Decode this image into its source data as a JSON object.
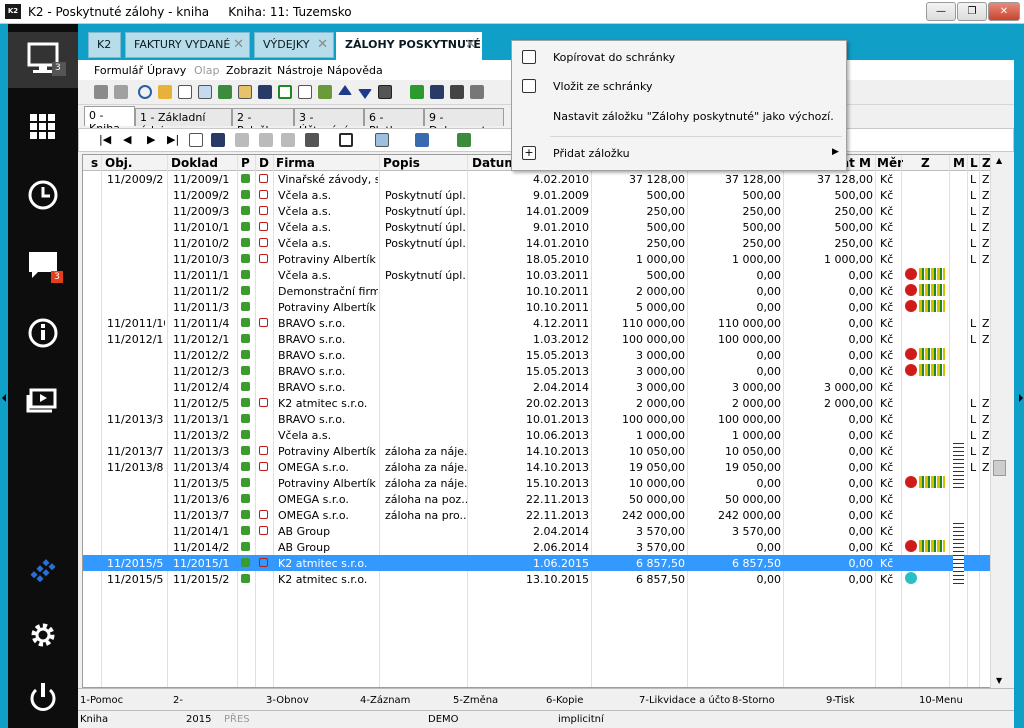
{
  "window": {
    "title": "K2 - Poskytnuté zálohy - kniha",
    "book": "Kniha: 11: Tuzemsko",
    "icon": "K2"
  },
  "sidebar": {
    "items": [
      {
        "name": "desktop-icon",
        "badge": "3"
      },
      {
        "name": "apps-grid-icon",
        "badge": ""
      },
      {
        "name": "history-icon",
        "badge": ""
      },
      {
        "name": "messages-icon",
        "badge": "3"
      },
      {
        "name": "info-icon",
        "badge": ""
      },
      {
        "name": "media-icon",
        "badge": ""
      },
      {
        "name": "k2-logo-icon",
        "badge": ""
      },
      {
        "name": "settings-icon",
        "badge": ""
      },
      {
        "name": "power-icon",
        "badge": ""
      }
    ]
  },
  "tabs": [
    {
      "label": "K2"
    },
    {
      "label": "FAKTURY VYDANÉ"
    },
    {
      "label": "VÝDEJKY"
    },
    {
      "label": "ZÁLOHY POSKYTNUTÉ"
    }
  ],
  "menu": [
    "Formulář",
    "Úpravy",
    "Olap",
    "Zobrazit",
    "Nástroje",
    "Nápověda"
  ],
  "subtabs": [
    "0 - Kniha",
    "1 - Základní údaje",
    "2 - Položky",
    "3 - Účtování",
    "6 - Platby",
    "9 - Dokumenty"
  ],
  "columns": [
    "s",
    "Obj.",
    "Doklad",
    "P",
    "D",
    "Firma",
    "Popis",
    "Datum",
    "at M",
    "Měr",
    "Z",
    "M",
    "L",
    "Z"
  ],
  "rows": [
    {
      "obj": "11/2009/2",
      "doklad": "11/2009/1",
      "dl": true,
      "firma": "Vinařské závody, s...",
      "popis": "",
      "datum": "4.02.2010",
      "a": "37 128,00",
      "b": "37 128,00",
      "c": "37 128,00",
      "mena": "Kč",
      "z": "",
      "m": "",
      "l": "L",
      "z2": "Z"
    },
    {
      "obj": "",
      "doklad": "11/2009/2",
      "dl": true,
      "firma": "Včela a.s.",
      "popis": "Poskytnutí úpl...",
      "datum": "9.01.2009",
      "a": "500,00",
      "b": "500,00",
      "c": "500,00",
      "mena": "Kč",
      "z": "",
      "m": "",
      "l": "L",
      "z2": "Z"
    },
    {
      "obj": "",
      "doklad": "11/2009/3",
      "dl": true,
      "firma": "Včela a.s.",
      "popis": "Poskytnutí úpl...",
      "datum": "14.01.2009",
      "a": "250,00",
      "b": "250,00",
      "c": "250,00",
      "mena": "Kč",
      "z": "",
      "m": "",
      "l": "L",
      "z2": "Z"
    },
    {
      "obj": "",
      "doklad": "11/2010/1",
      "dl": true,
      "firma": "Včela a.s.",
      "popis": "Poskytnutí úpl...",
      "datum": "9.01.2010",
      "a": "500,00",
      "b": "500,00",
      "c": "500,00",
      "mena": "Kč",
      "z": "",
      "m": "",
      "l": "L",
      "z2": "Z"
    },
    {
      "obj": "",
      "doklad": "11/2010/2",
      "dl": true,
      "firma": "Včela a.s.",
      "popis": "Poskytnutí úpl...",
      "datum": "14.01.2010",
      "a": "250,00",
      "b": "250,00",
      "c": "250,00",
      "mena": "Kč",
      "z": "",
      "m": "",
      "l": "L",
      "z2": "Z"
    },
    {
      "obj": "",
      "doklad": "11/2010/3",
      "dl": true,
      "firma": "Potraviny Albertík",
      "popis": "",
      "datum": "18.05.2010",
      "a": "1 000,00",
      "b": "1 000,00",
      "c": "1 000,00",
      "mena": "Kč",
      "z": "",
      "m": "",
      "l": "L",
      "z2": "Z"
    },
    {
      "obj": "",
      "doklad": "11/2011/1",
      "dl": false,
      "firma": "Včela a.s.",
      "popis": "Poskytnutí úpl...",
      "datum": "10.03.2011",
      "a": "500,00",
      "b": "0,00",
      "c": "0,00",
      "mena": "Kč",
      "z": "red",
      "m": "",
      "l": "",
      "z2": ""
    },
    {
      "obj": "",
      "doklad": "11/2011/2",
      "dl": false,
      "firma": "Demonstrační firm...",
      "popis": "",
      "datum": "10.10.2011",
      "a": "2 000,00",
      "b": "0,00",
      "c": "0,00",
      "mena": "Kč",
      "z": "red",
      "m": "",
      "l": "",
      "z2": ""
    },
    {
      "obj": "",
      "doklad": "11/2011/3",
      "dl": false,
      "firma": "Potraviny Albertík",
      "popis": "",
      "datum": "10.10.2011",
      "a": "5 000,00",
      "b": "0,00",
      "c": "0,00",
      "mena": "Kč",
      "z": "red",
      "m": "",
      "l": "",
      "z2": ""
    },
    {
      "obj": "11/2011/10",
      "doklad": "11/2011/4",
      "dl": true,
      "firma": "BRAVO s.r.o.",
      "popis": "",
      "datum": "4.12.2011",
      "a": "110 000,00",
      "b": "110 000,00",
      "c": "0,00",
      "mena": "Kč",
      "z": "",
      "m": "",
      "l": "L",
      "z2": "Z"
    },
    {
      "obj": "11/2012/1",
      "doklad": "11/2012/1",
      "dl": false,
      "firma": "BRAVO s.r.o.",
      "popis": "",
      "datum": "1.03.2012",
      "a": "100 000,00",
      "b": "100 000,00",
      "c": "0,00",
      "mena": "Kč",
      "z": "",
      "m": "",
      "l": "L",
      "z2": "Z"
    },
    {
      "obj": "",
      "doklad": "11/2012/2",
      "dl": false,
      "firma": "BRAVO s.r.o.",
      "popis": "",
      "datum": "15.05.2013",
      "a": "3 000,00",
      "b": "0,00",
      "c": "0,00",
      "mena": "Kč",
      "z": "red",
      "m": "",
      "l": "",
      "z2": ""
    },
    {
      "obj": "",
      "doklad": "11/2012/3",
      "dl": false,
      "firma": "BRAVO s.r.o.",
      "popis": "",
      "datum": "15.05.2013",
      "a": "3 000,00",
      "b": "0,00",
      "c": "0,00",
      "mena": "Kč",
      "z": "red",
      "m": "",
      "l": "",
      "z2": ""
    },
    {
      "obj": "",
      "doklad": "11/2012/4",
      "dl": false,
      "firma": "BRAVO s.r.o.",
      "popis": "",
      "datum": "2.04.2014",
      "a": "3 000,00",
      "b": "3 000,00",
      "c": "3 000,00",
      "mena": "Kč",
      "z": "",
      "m": "",
      "l": "",
      "z2": ""
    },
    {
      "obj": "",
      "doklad": "11/2012/5",
      "dl": true,
      "firma": "K2 atmitec s.r.o.",
      "popis": "",
      "datum": "20.02.2013",
      "a": "2 000,00",
      "b": "2 000,00",
      "c": "2 000,00",
      "mena": "Kč",
      "z": "",
      "m": "",
      "l": "L",
      "z2": "Z"
    },
    {
      "obj": "11/2013/3",
      "doklad": "11/2013/1",
      "dl": false,
      "firma": "BRAVO s.r.o.",
      "popis": "",
      "datum": "10.01.2013",
      "a": "100 000,00",
      "b": "100 000,00",
      "c": "0,00",
      "mena": "Kč",
      "z": "",
      "m": "",
      "l": "L",
      "z2": "Z"
    },
    {
      "obj": "",
      "doklad": "11/2013/2",
      "dl": false,
      "firma": "Včela a.s.",
      "popis": "",
      "datum": "10.06.2013",
      "a": "1 000,00",
      "b": "1 000,00",
      "c": "0,00",
      "mena": "Kč",
      "z": "",
      "m": "",
      "l": "L",
      "z2": "Z"
    },
    {
      "obj": "11/2013/7",
      "doklad": "11/2013/3",
      "dl": true,
      "firma": "Potraviny Albertík",
      "popis": "záloha za náje...",
      "datum": "14.10.2013",
      "a": "10 050,00",
      "b": "10 050,00",
      "c": "0,00",
      "mena": "Kč",
      "z": "",
      "m": "tree",
      "l": "L",
      "z2": "Z"
    },
    {
      "obj": "11/2013/8",
      "doklad": "11/2013/4",
      "dl": true,
      "firma": "OMEGA s.r.o.",
      "popis": "záloha za náje...",
      "datum": "14.10.2013",
      "a": "19 050,00",
      "b": "19 050,00",
      "c": "0,00",
      "mena": "Kč",
      "z": "",
      "m": "tree",
      "l": "L",
      "z2": "Z"
    },
    {
      "obj": "",
      "doklad": "11/2013/5",
      "dl": false,
      "firma": "Potraviny Albertík",
      "popis": "záloha za náje...",
      "datum": "15.10.2013",
      "a": "10 000,00",
      "b": "0,00",
      "c": "0,00",
      "mena": "Kč",
      "z": "red",
      "m": "tree",
      "l": "",
      "z2": ""
    },
    {
      "obj": "",
      "doklad": "11/2013/6",
      "dl": false,
      "firma": "OMEGA s.r.o.",
      "popis": "záloha na poz...",
      "datum": "22.11.2013",
      "a": "50 000,00",
      "b": "50 000,00",
      "c": "0,00",
      "mena": "Kč",
      "z": "",
      "m": "",
      "l": "",
      "z2": ""
    },
    {
      "obj": "",
      "doklad": "11/2013/7",
      "dl": true,
      "firma": "OMEGA s.r.o.",
      "popis": "záloha na pro...",
      "datum": "22.11.2013",
      "a": "242 000,00",
      "b": "242 000,00",
      "c": "0,00",
      "mena": "Kč",
      "z": "",
      "m": "",
      "l": "",
      "z2": ""
    },
    {
      "obj": "",
      "doklad": "11/2014/1",
      "dl": true,
      "firma": "AB Group",
      "popis": "",
      "datum": "2.04.2014",
      "a": "3 570,00",
      "b": "3 570,00",
      "c": "0,00",
      "mena": "Kč",
      "z": "",
      "m": "tree",
      "l": "",
      "z2": ""
    },
    {
      "obj": "",
      "doklad": "11/2014/2",
      "dl": false,
      "firma": "AB Group",
      "popis": "",
      "datum": "2.06.2014",
      "a": "3 570,00",
      "b": "0,00",
      "c": "0,00",
      "mena": "Kč",
      "z": "red",
      "m": "tree",
      "l": "",
      "z2": ""
    },
    {
      "obj": "11/2015/5",
      "doklad": "11/2015/1",
      "dl": true,
      "firma": "K2 atmitec s.r.o.",
      "popis": "",
      "datum": "1.06.2015",
      "a": "6 857,50",
      "b": "6 857,50",
      "c": "0,00",
      "mena": "Kč",
      "z": "",
      "m": "tree",
      "l": "",
      "z2": "",
      "selected": true
    },
    {
      "obj": "11/2015/5",
      "doklad": "11/2015/2",
      "dl": false,
      "firma": "K2 atmitec s.r.o.",
      "popis": "",
      "datum": "13.10.2015",
      "a": "6 857,50",
      "b": "0,00",
      "c": "0,00",
      "mena": "Kč",
      "z": "green",
      "m": "tree",
      "l": "",
      "z2": ""
    }
  ],
  "context_menu": {
    "items": [
      {
        "label": "Kopírovat do schránky",
        "icon": "copy-icon"
      },
      {
        "label": "Vložit ze schránky",
        "icon": "paste-icon"
      },
      {
        "label": "Nastavit záložku \"Zálohy poskytnuté\" jako výchozí.",
        "icon": ""
      },
      {
        "label": "Přidat záložku",
        "icon": "add-icon",
        "submenu": true
      }
    ]
  },
  "fkeys": [
    "1-Pomoc",
    "2-",
    "3-Obnov",
    "4-Záznam",
    "5-Změna",
    "6-Kopie",
    "7-Likvidace a účtov",
    "8-Storno",
    "9-Tisk",
    "10-Menu"
  ],
  "status": {
    "s1": "Kniha",
    "s2": "2015",
    "s3": "PŘES",
    "s4": "DEMO",
    "s5": "implicitní"
  },
  "colors": {
    "accent": "#0f9fc7",
    "selection": "#3399ff",
    "sidebar": "#0d0d0d",
    "badge": "#e2401c"
  }
}
